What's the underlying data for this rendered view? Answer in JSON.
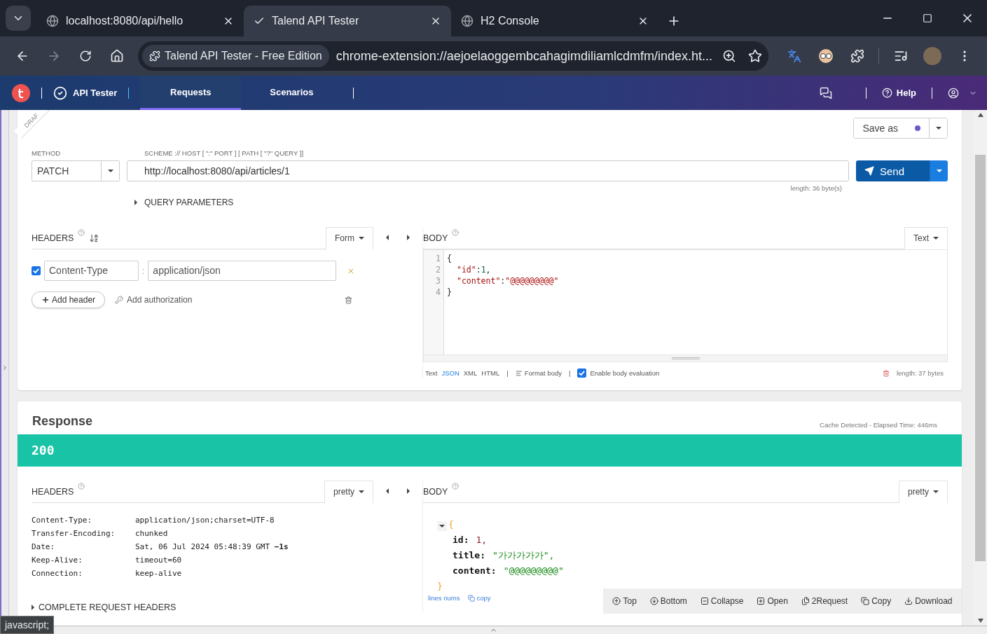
{
  "browser": {
    "tabs": [
      {
        "title": "localhost:8080/api/hello",
        "selected": false
      },
      {
        "title": "Talend API Tester",
        "selected": true
      },
      {
        "title": "H2 Console",
        "selected": false
      }
    ],
    "omnibox": {
      "chip": "Talend API Tester - Free Edition",
      "url": "chrome-extension://aejoelaoggembcahagimdiliamlcdmfm/index.ht..."
    }
  },
  "app_nav": {
    "brand": "API Tester",
    "tabs": [
      {
        "label": "Requests",
        "selected": true
      },
      {
        "label": "Scenarios",
        "selected": false
      }
    ],
    "help": "Help"
  },
  "request": {
    "ribbon": "DRAF",
    "save_as": {
      "label": "Save as",
      "unsaved": true
    },
    "method_label": "METHOD",
    "method": "PATCH",
    "url_label": "SCHEME :// HOST [ \":\" PORT ] [ PATH [ \"?\" QUERY ]]",
    "url": "http://localhost:8080/api/articles/1",
    "send": "Send",
    "url_length": "length: 36 byte(s)",
    "query_parameters": "QUERY PARAMETERS",
    "headers": {
      "label": "HEADERS",
      "mode": "Form",
      "rows": [
        {
          "enabled": true,
          "name": "Content-Type",
          "separator": ":",
          "value": "application/json"
        }
      ],
      "add_header": "Add header",
      "add_authorization": "Add authorization"
    },
    "body": {
      "label": "BODY",
      "mode": "Text",
      "lines": [
        [
          {
            "kind": "punct",
            "text": "{"
          }
        ],
        [
          {
            "kind": "key",
            "text": "\"id\""
          },
          {
            "kind": "punct",
            "text": ":"
          },
          {
            "kind": "number",
            "text": "1"
          },
          {
            "kind": "punct",
            "text": ","
          }
        ],
        [
          {
            "kind": "key",
            "text": "\"content\""
          },
          {
            "kind": "punct",
            "text": ":"
          },
          {
            "kind": "string",
            "text": "\"@@@@@@@@@\""
          }
        ],
        [
          {
            "kind": "punct",
            "text": "}"
          }
        ]
      ],
      "line_numbers": [
        "1",
        "2",
        "3",
        "4"
      ],
      "formats": [
        {
          "label": "Text",
          "selected": false
        },
        {
          "label": "JSON",
          "selected": true
        },
        {
          "label": "XML",
          "selected": false
        },
        {
          "label": "HTML",
          "selected": false
        }
      ],
      "separator": "|",
      "format_body": "Format body",
      "separator_2": "|",
      "evaluation": {
        "label": "Enable body evaluation",
        "checked": true
      },
      "length": "length: 37 bytes"
    }
  },
  "response": {
    "title": "Response",
    "timing": "Cache Detected - Elapsed Time: 446ms",
    "status": "200",
    "headers": {
      "label": "HEADERS",
      "mode": "pretty",
      "rows": [
        {
          "name": "Content-Type:",
          "value": "application/json;charset=UTF-8"
        },
        {
          "name": "Transfer-Encoding:",
          "value": "chunked"
        },
        {
          "name": "Date:",
          "value": "Sat, 06 Jul 2024 05:48:39 GMT **−1s**"
        },
        {
          "name": "Keep-Alive:",
          "value": "timeout=60"
        },
        {
          "name": "Connection:",
          "value": "keep-alive"
        }
      ],
      "complete": "COMPLETE REQUEST HEADERS"
    },
    "body": {
      "label": "BODY",
      "mode": "pretty",
      "open_brace": "{",
      "close_brace": "}",
      "fields": [
        {
          "key": "id:",
          "value": "1,",
          "kind": "number"
        },
        {
          "key": "title:",
          "value": "\"가가가가가\",",
          "kind": "string"
        },
        {
          "key": "content:",
          "value": "\"@@@@@@@@@\"",
          "kind": "string"
        }
      ],
      "lines_nums": "lines nums",
      "copy": "copy",
      "tools": [
        "Top",
        "Bottom",
        "Collapse",
        "Open",
        "2Request",
        "Copy",
        "Download"
      ]
    }
  },
  "status_tip": "javascript;"
}
